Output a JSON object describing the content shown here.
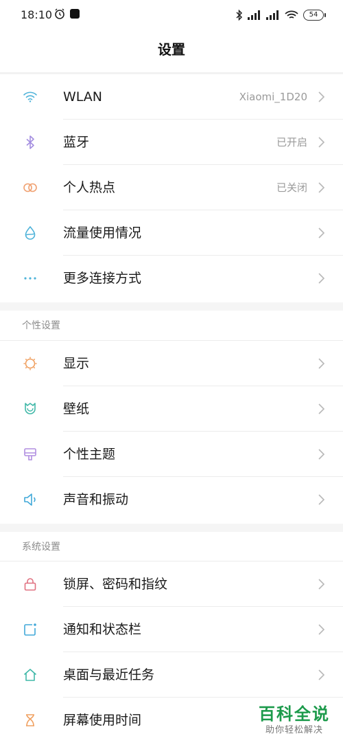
{
  "status_bar": {
    "time": "18:10",
    "battery": "54"
  },
  "header": {
    "title": "设置"
  },
  "connectivity": [
    {
      "label": "WLAN",
      "value": "Xiaomi_1D20",
      "icon": "wifi-icon"
    },
    {
      "label": "蓝牙",
      "value": "已开启",
      "icon": "bluetooth-icon"
    },
    {
      "label": "个人热点",
      "value": "已关闭",
      "icon": "hotspot-icon"
    },
    {
      "label": "流量使用情况",
      "value": "",
      "icon": "data-usage-icon"
    },
    {
      "label": "更多连接方式",
      "value": "",
      "icon": "more-dots-icon"
    }
  ],
  "personal": {
    "header": "个性设置",
    "items": [
      {
        "label": "显示",
        "icon": "display-icon"
      },
      {
        "label": "壁纸",
        "icon": "wallpaper-icon"
      },
      {
        "label": "个性主题",
        "icon": "theme-icon"
      },
      {
        "label": "声音和振动",
        "icon": "sound-icon"
      }
    ]
  },
  "system": {
    "header": "系统设置",
    "items": [
      {
        "label": "锁屏、密码和指纹",
        "icon": "lock-icon"
      },
      {
        "label": "通知和状态栏",
        "icon": "notification-icon"
      },
      {
        "label": "桌面与最近任务",
        "icon": "home-icon"
      },
      {
        "label": "屏幕使用时间",
        "icon": "hourglass-icon"
      }
    ]
  },
  "watermark": {
    "title": "百科全说",
    "subtitle": "助你轻松解决"
  },
  "colors": {
    "wifi": "#4fb3d9",
    "bluetooth": "#a48ee0",
    "hotspot": "#f0a070",
    "data": "#4fb3d9",
    "more": "#4fb3d9",
    "display": "#f0a060",
    "wallpaper": "#40b8a8",
    "theme": "#b08ee0",
    "sound": "#40a8d8",
    "lock": "#e07080",
    "notification": "#40a8d8",
    "home": "#40b8a8",
    "hourglass": "#f0a060",
    "watermark": "#1c9a4b"
  }
}
